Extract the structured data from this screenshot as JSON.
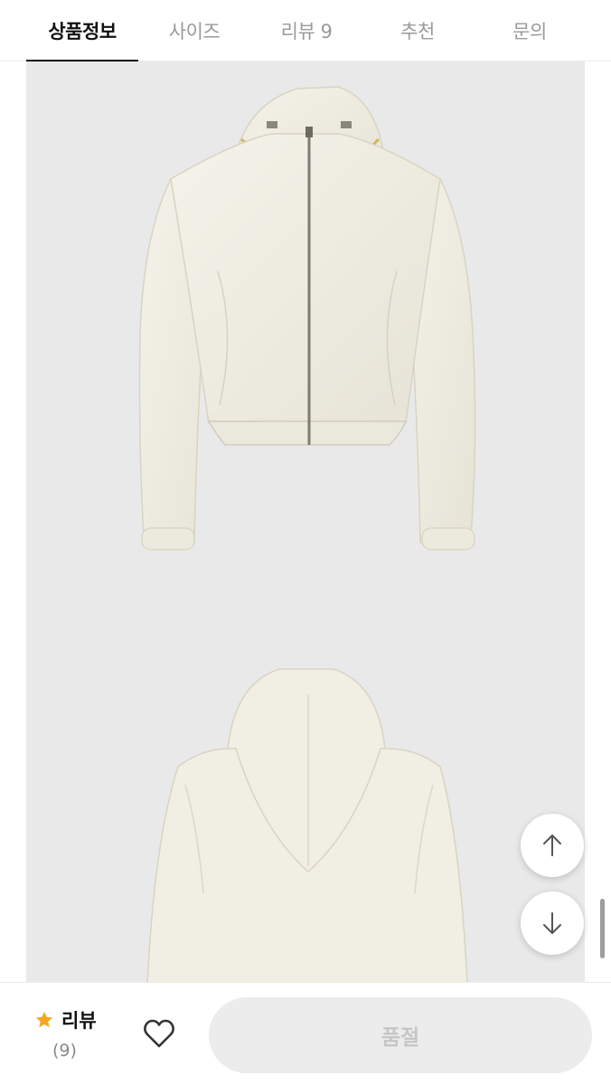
{
  "tabs": [
    {
      "label": "상품정보",
      "active": true
    },
    {
      "label": "사이즈",
      "active": false
    },
    {
      "label": "리뷰 9",
      "active": false
    },
    {
      "label": "추천",
      "active": false
    },
    {
      "label": "문의",
      "active": false
    }
  ],
  "images": [
    {
      "name": "jacket-front-image",
      "color": "#f1efe4"
    },
    {
      "name": "jacket-back-image",
      "color": "#f1efe4"
    }
  ],
  "floating_buttons": {
    "up_icon": "arrow-up-icon",
    "down_icon": "arrow-down-icon"
  },
  "bottom_bar": {
    "review_icon": "star-icon",
    "review_label": "리뷰",
    "review_count": "(9)",
    "wishlist_icon": "heart-icon",
    "soldout_label": "품절"
  },
  "colors": {
    "active_tab": "#111111",
    "inactive_tab": "#9a9a9a",
    "star": "#f5a623",
    "image_bg": "#e9e9e9",
    "soldout_bg": "#ececec",
    "soldout_text": "#c6c6c6"
  }
}
